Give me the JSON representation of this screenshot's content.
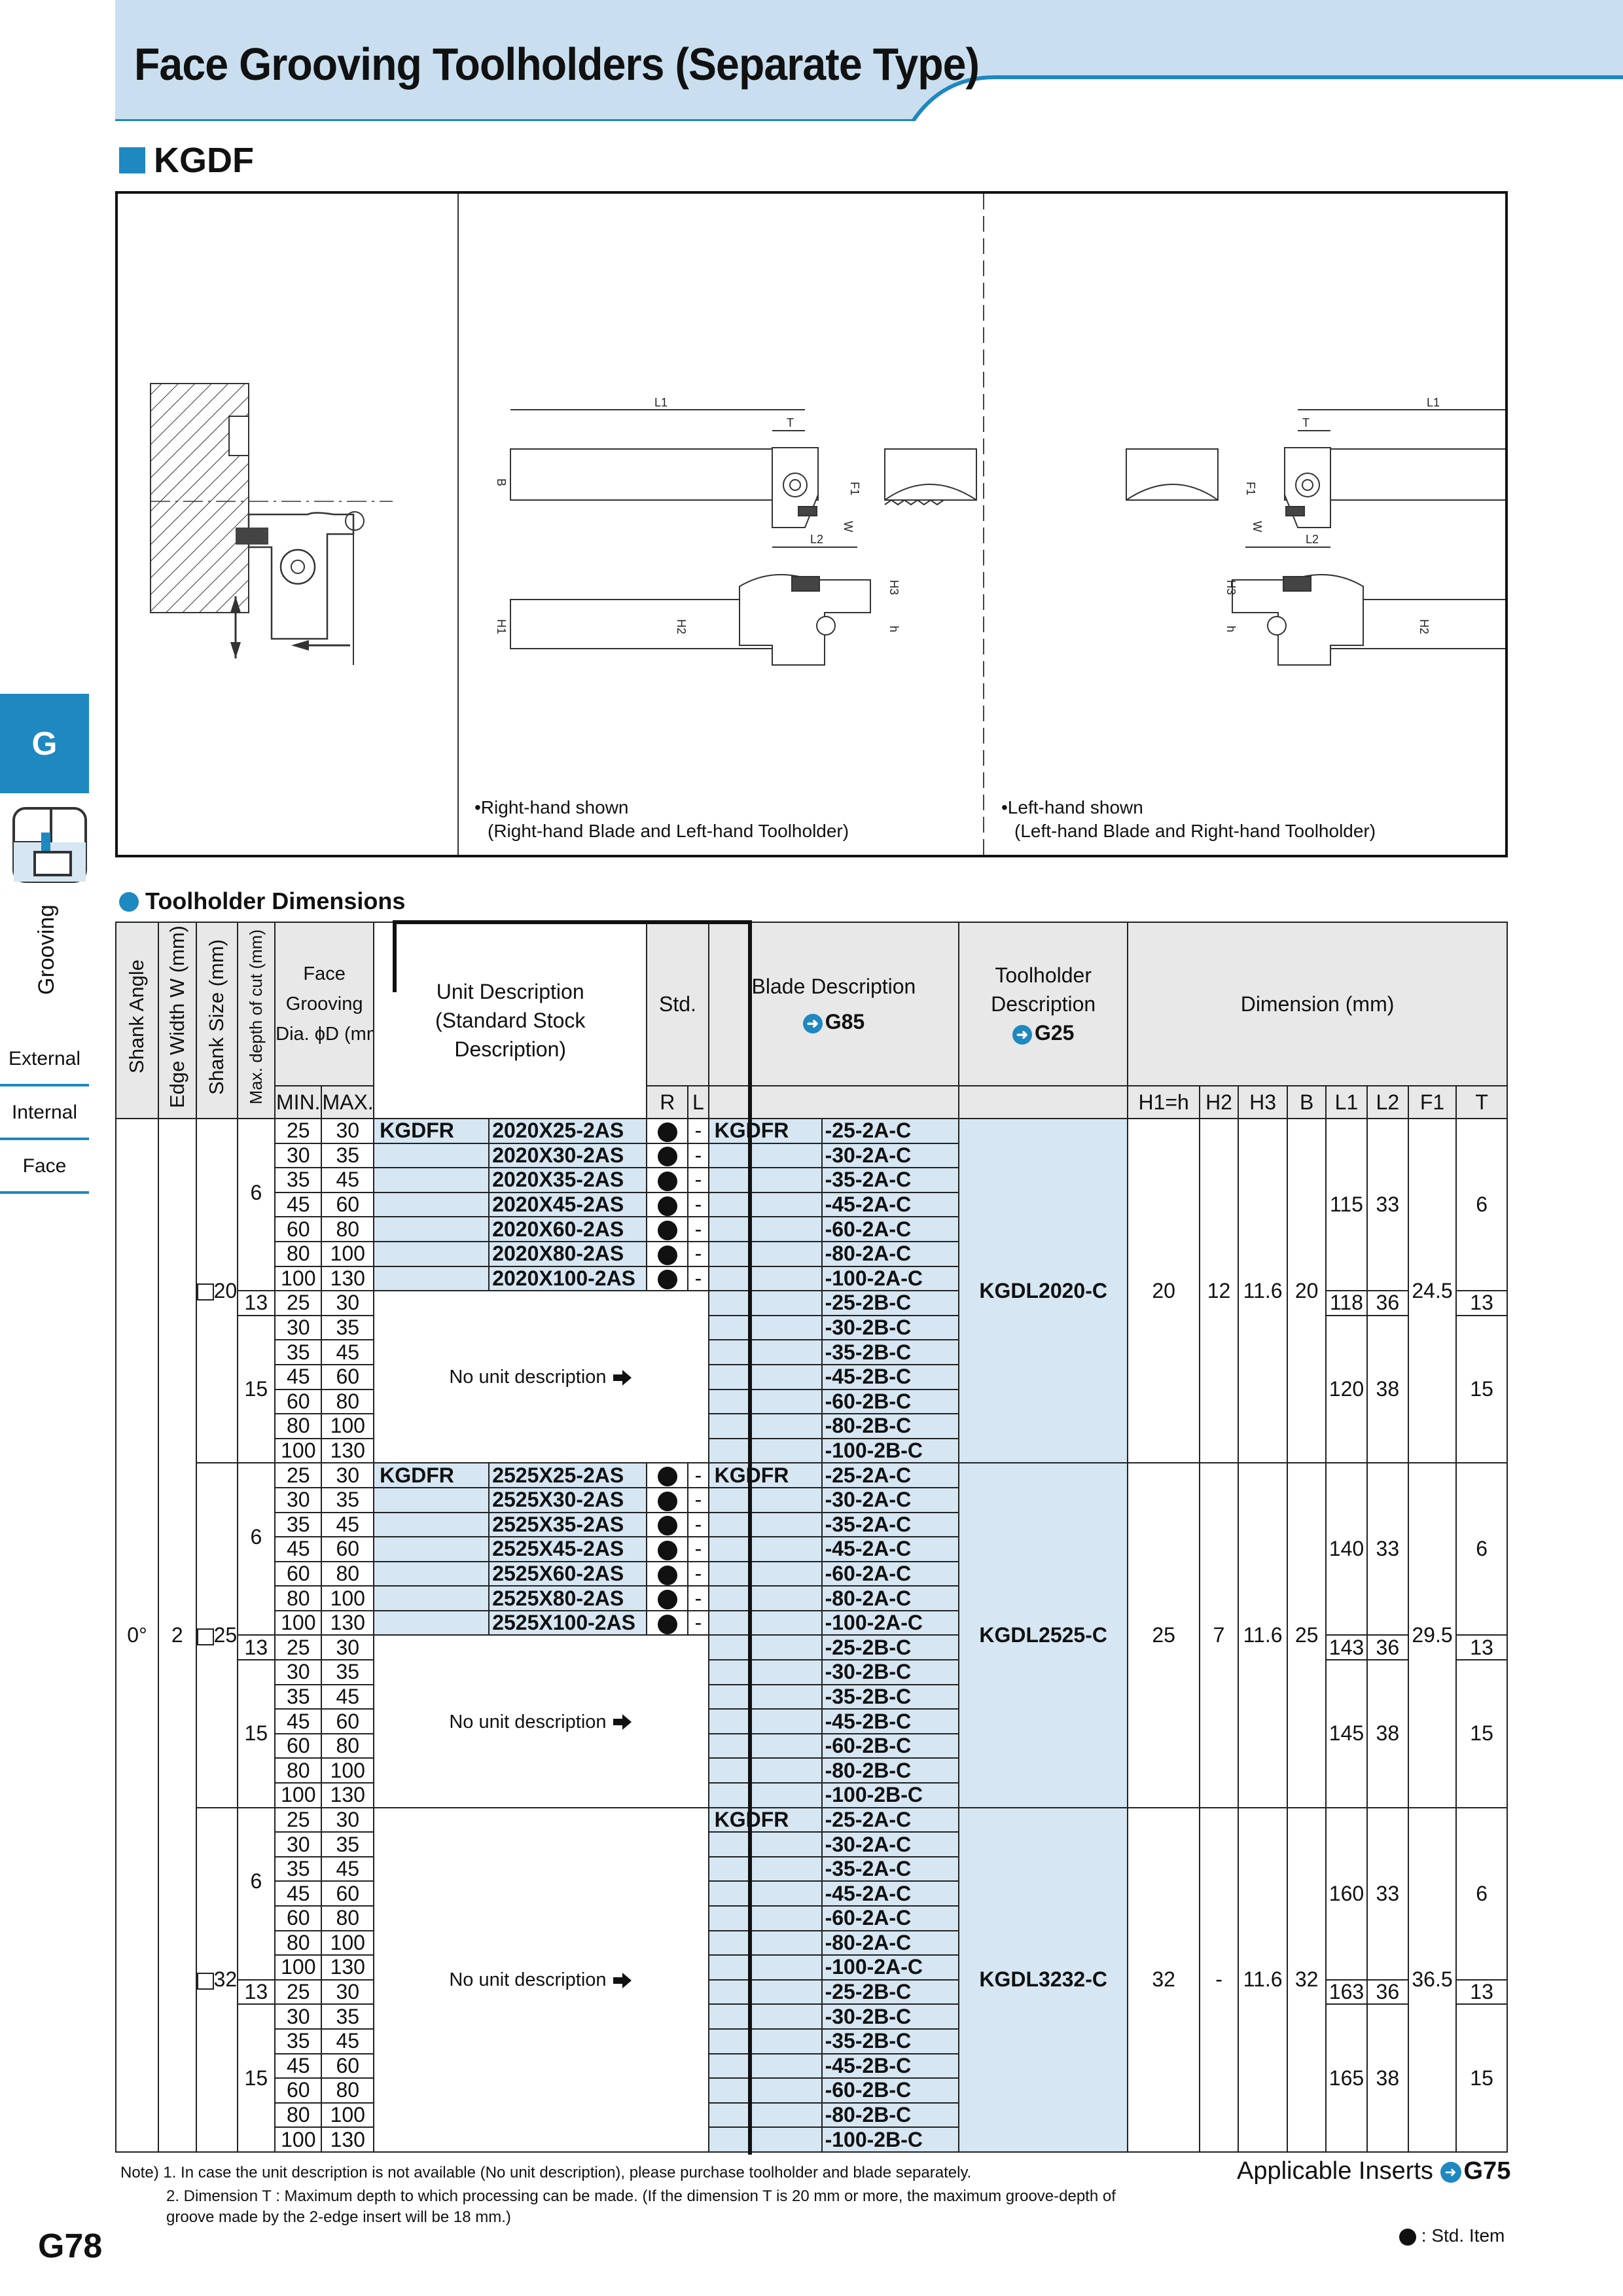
{
  "page": {
    "title": "Face Grooving Toolholders (Separate Type)",
    "section_code": "KGDF",
    "page_number": "G78"
  },
  "sidebar": {
    "tab": "G",
    "category": "Grooving",
    "items": [
      {
        "label": "External"
      },
      {
        "label": "Internal"
      },
      {
        "label": "Face"
      }
    ]
  },
  "diagram": {
    "right_caption": "•Right-hand shown",
    "right_caption_sub": "(Right-hand Blade and Left-hand Toolholder)",
    "left_caption": "•Left-hand shown",
    "left_caption_sub": "(Left-hand Blade and Right-hand Toolholder)",
    "labels": {
      "L1": "L1",
      "L2": "L2",
      "T": "T",
      "B": "B",
      "F1": "F1",
      "W": "W",
      "H1": "H1",
      "H2": "H2",
      "H3": "H3",
      "h": "h"
    }
  },
  "table": {
    "heading": "Toolholder Dimensions",
    "headers": {
      "shank_angle": "Shank Angle",
      "edge_width": "Edge Width W (mm)",
      "shank_size": "Shank Size (mm)",
      "max_depth": "Max. depth of cut (mm)",
      "face_dia_1": "Face",
      "face_dia_2": "Grooving",
      "face_dia_3": "Dia. ϕD (mm)",
      "unit_1": "Unit Description",
      "unit_2": "(Standard Stock",
      "unit_3": "Description)",
      "std": "Std.",
      "blade": "Blade Description",
      "blade_ref": "G85",
      "toolholder_1": "Toolholder",
      "toolholder_2": "Description",
      "toolholder_ref": "G25",
      "dimension": "Dimension (mm)",
      "min": "MIN.",
      "max": "MAX.",
      "r": "R",
      "l": "L",
      "h1h": "H1=h",
      "h2": "H2",
      "h3": "H3",
      "b": "B",
      "l1": "L1",
      "l2": "L2",
      "f1": "F1",
      "t": "T"
    },
    "shank_angle": "0°",
    "edge_width": "2",
    "no_unit": "No unit description",
    "unit_prefix": "KGDFR",
    "blade_prefix": "KGDFR",
    "dash": "-",
    "ranges": [
      [
        "25",
        "30"
      ],
      [
        "30",
        "35"
      ],
      [
        "35",
        "45"
      ],
      [
        "45",
        "60"
      ],
      [
        "60",
        "80"
      ],
      [
        "80",
        "100"
      ],
      [
        "100",
        "130"
      ]
    ],
    "groups": [
      {
        "shank": "20",
        "toolholder": "KGDL2020-C",
        "h1h": "20",
        "h2": "12",
        "h3": "11.6",
        "b": "20",
        "f1": "24.5",
        "depth_a": "6",
        "depth_b": "15",
        "mid_depth": "13",
        "l1_a": "115",
        "l2_a": "33",
        "t_a": "6",
        "l1_mid": "118",
        "l2_mid": "36",
        "t_mid": "13",
        "l1_b": "120",
        "l2_b": "38",
        "t_b": "15",
        "units": [
          "2020X25-2AS",
          "2020X30-2AS",
          "2020X35-2AS",
          "2020X45-2AS",
          "2020X60-2AS",
          "2020X80-2AS",
          "2020X100-2AS"
        ]
      },
      {
        "shank": "25",
        "toolholder": "KGDL2525-C",
        "h1h": "25",
        "h2": "7",
        "h3": "11.6",
        "b": "25",
        "f1": "29.5",
        "depth_a": "6",
        "depth_b": "15",
        "mid_depth": "13",
        "l1_a": "140",
        "l2_a": "33",
        "t_a": "6",
        "l1_mid": "143",
        "l2_mid": "36",
        "t_mid": "13",
        "l1_b": "145",
        "l2_b": "38",
        "t_b": "15",
        "units": [
          "2525X25-2AS",
          "2525X30-2AS",
          "2525X35-2AS",
          "2525X45-2AS",
          "2525X60-2AS",
          "2525X80-2AS",
          "2525X100-2AS"
        ]
      },
      {
        "shank": "32",
        "toolholder": "KGDL3232-C",
        "h1h": "32",
        "h2": "-",
        "h3": "11.6",
        "b": "32",
        "f1": "36.5",
        "depth_a": "6",
        "depth_b": "15",
        "mid_depth": "13",
        "l1_a": "160",
        "l2_a": "33",
        "t_a": "6",
        "l1_mid": "163",
        "l2_mid": "36",
        "t_mid": "13",
        "l1_b": "165",
        "l2_b": "38",
        "t_b": "15",
        "units": []
      }
    ],
    "blades_a": [
      "-25-2A-C",
      "-30-2A-C",
      "-35-2A-C",
      "-45-2A-C",
      "-60-2A-C",
      "-80-2A-C",
      "-100-2A-C"
    ],
    "blades_b": [
      "-25-2B-C",
      "-30-2B-C",
      "-35-2B-C",
      "-45-2B-C",
      "-60-2B-C",
      "-80-2B-C",
      "-100-2B-C"
    ]
  },
  "notes": {
    "note1": "Note) 1. In case the unit description is not available (No unit description), please purchase toolholder and blade separately.",
    "note2": "2. Dimension T : Maximum depth to which processing can be made. (If the dimension T is 20 mm or more, the maximum groove-depth of groove made by the 2-edge insert will be 18 mm.)"
  },
  "applicable": {
    "label": "Applicable Inserts",
    "ref": "G75"
  },
  "legend": ": Std. Item",
  "colors": {
    "accent": "#1e88c0",
    "header_bg": "#c9dfef",
    "cell_highlight": "#d6e6f2"
  }
}
